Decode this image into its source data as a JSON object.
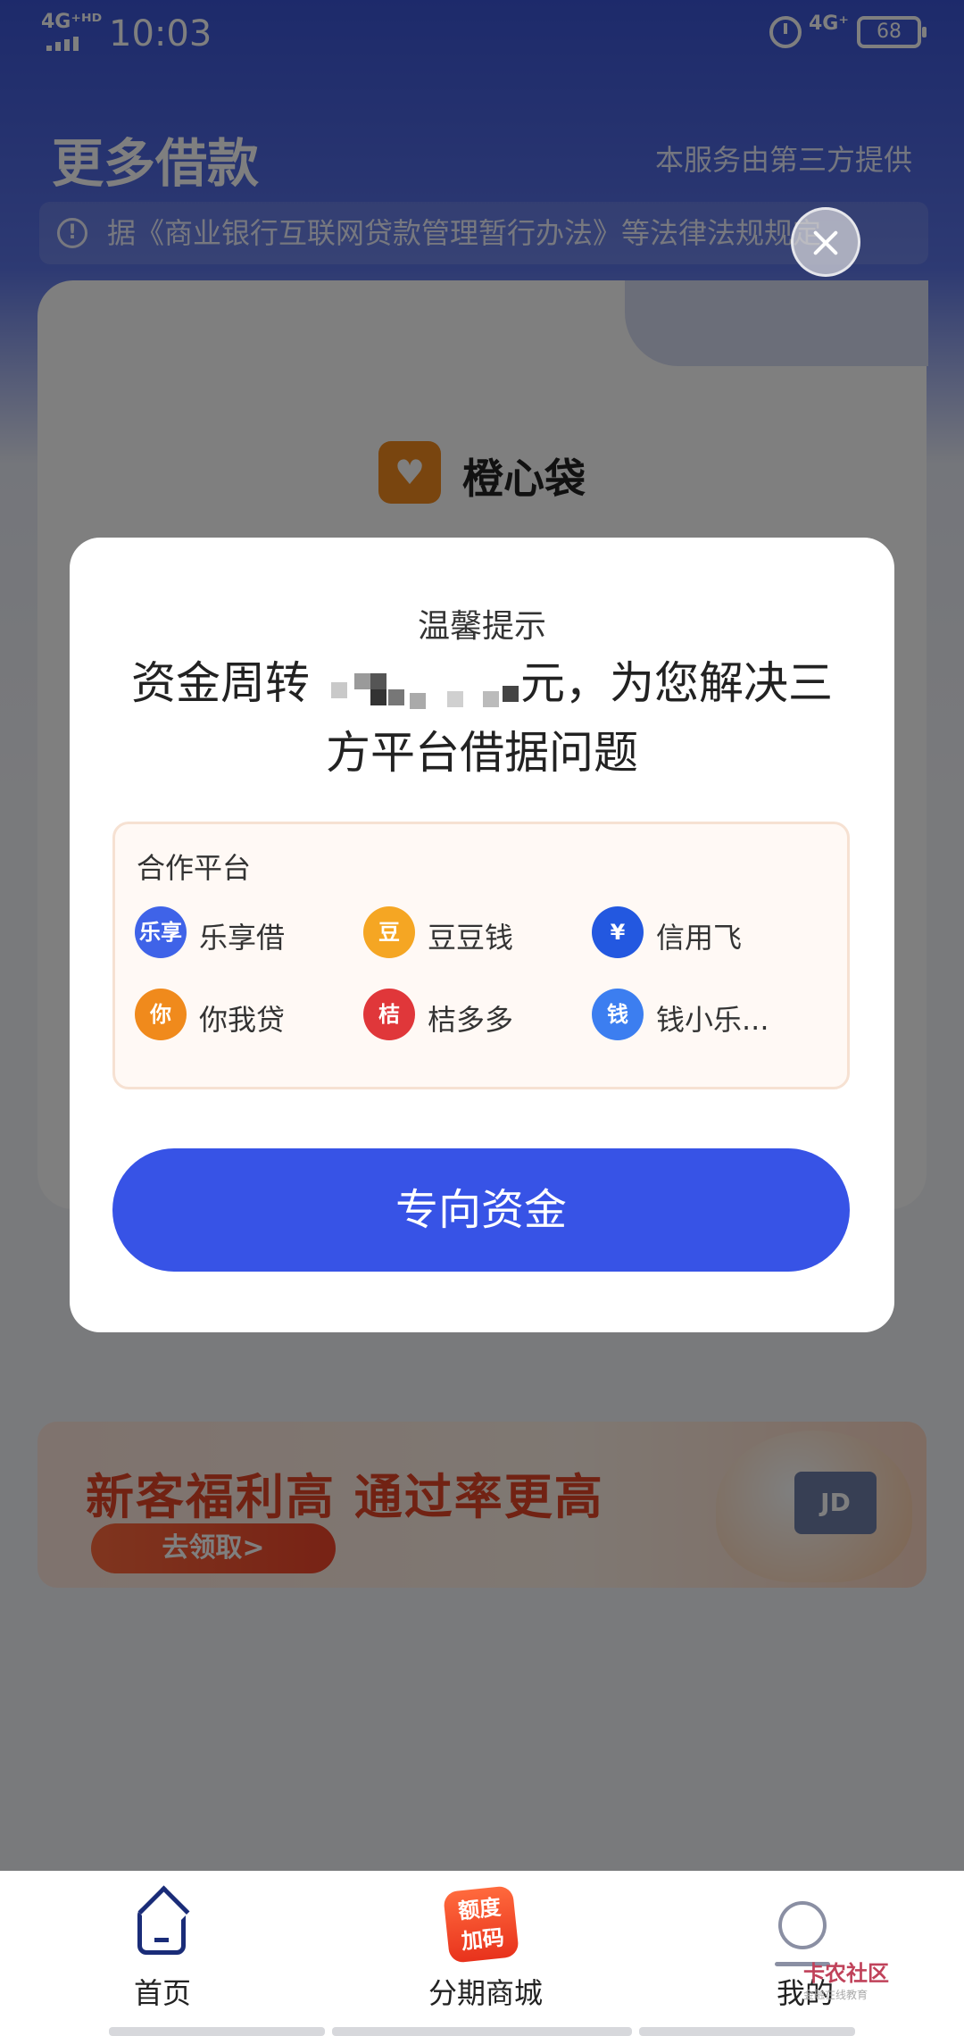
{
  "status_bar": {
    "signal": "4G⁺ᴴᴰ",
    "time": "10:03",
    "network": "4G⁺",
    "battery": "68"
  },
  "page": {
    "title": "更多借款",
    "provider": "本服务由第三方提供",
    "notice": "据《商业银行互联网贷款管理暂行办法》等法律法规规定",
    "product": {
      "name": "橙心袋"
    }
  },
  "banner": {
    "title": "新客福利高 通过率更高",
    "button": "去领取>",
    "card_text": "JD"
  },
  "modal": {
    "tip": "温馨提示",
    "message_pre": "资金周转",
    "message_post": "元，为您解决三方平台借据问题",
    "partners_heading": "合作平台",
    "partners": [
      {
        "name": "乐享借",
        "logo_text": "乐享",
        "color": "#3f63e8"
      },
      {
        "name": "豆豆钱",
        "logo_text": "豆",
        "color": "#f5a623"
      },
      {
        "name": "信用飞",
        "logo_text": "¥",
        "color": "#2358e0"
      },
      {
        "name": "你我贷",
        "logo_text": "你",
        "color": "#f08a1c"
      },
      {
        "name": "桔多多",
        "logo_text": "桔",
        "color": "#e0373a"
      },
      {
        "name": "钱小乐...",
        "logo_text": "钱",
        "color": "#3c7ef0"
      }
    ],
    "cta": "专向资金"
  },
  "bottom_nav": {
    "items": [
      {
        "label": "首页",
        "icon": "home-icon"
      },
      {
        "label": "分期商城",
        "icon": "mall-badge-icon",
        "badge": "额度\n加码"
      },
      {
        "label": "我的",
        "icon": "profile-icon"
      }
    ]
  },
  "watermark": {
    "title": "卡农社区",
    "subtitle": "金融在线教育"
  }
}
